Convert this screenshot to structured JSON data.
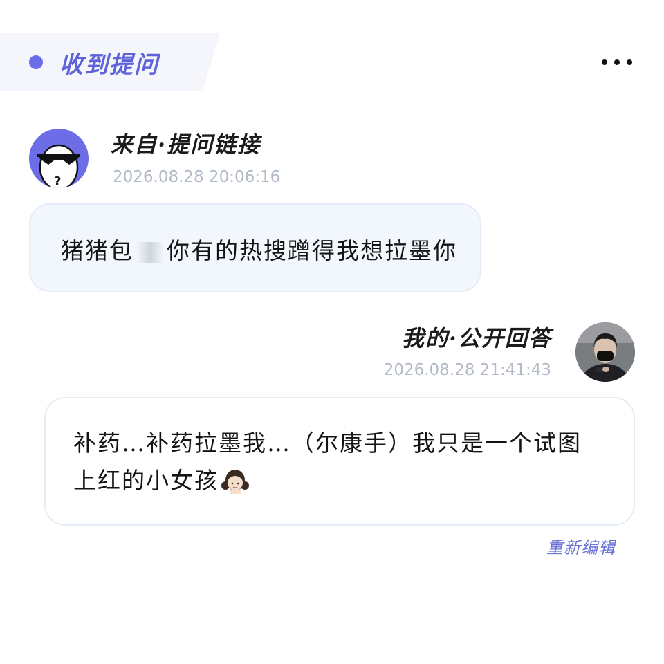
{
  "header": {
    "title": "收到提问"
  },
  "question": {
    "source": "来自·提问链接",
    "time": "2026.08.28 20:06:16",
    "text_before": "猪猪包",
    "text_after": "你有的热搜蹭得我想拉墨你"
  },
  "answer": {
    "label": "我的·公开回答",
    "time": "2026.08.28 21:41:43",
    "text": "补药…补药拉墨我…（尔康手）我只是一个试图上红的小女孩"
  },
  "actions": {
    "edit_label": "重新编辑"
  },
  "icons": {
    "more": "more-dots-icon",
    "question_avatar": "anonymous-sunglasses-avatar",
    "answer_avatar": "user-photo-avatar",
    "girl_emoji": "girl-emoji-icon"
  },
  "colors": {
    "accent": "#6b6de6",
    "timestamp": "#b1bac6",
    "question_bubble": "#f2f7fd"
  }
}
